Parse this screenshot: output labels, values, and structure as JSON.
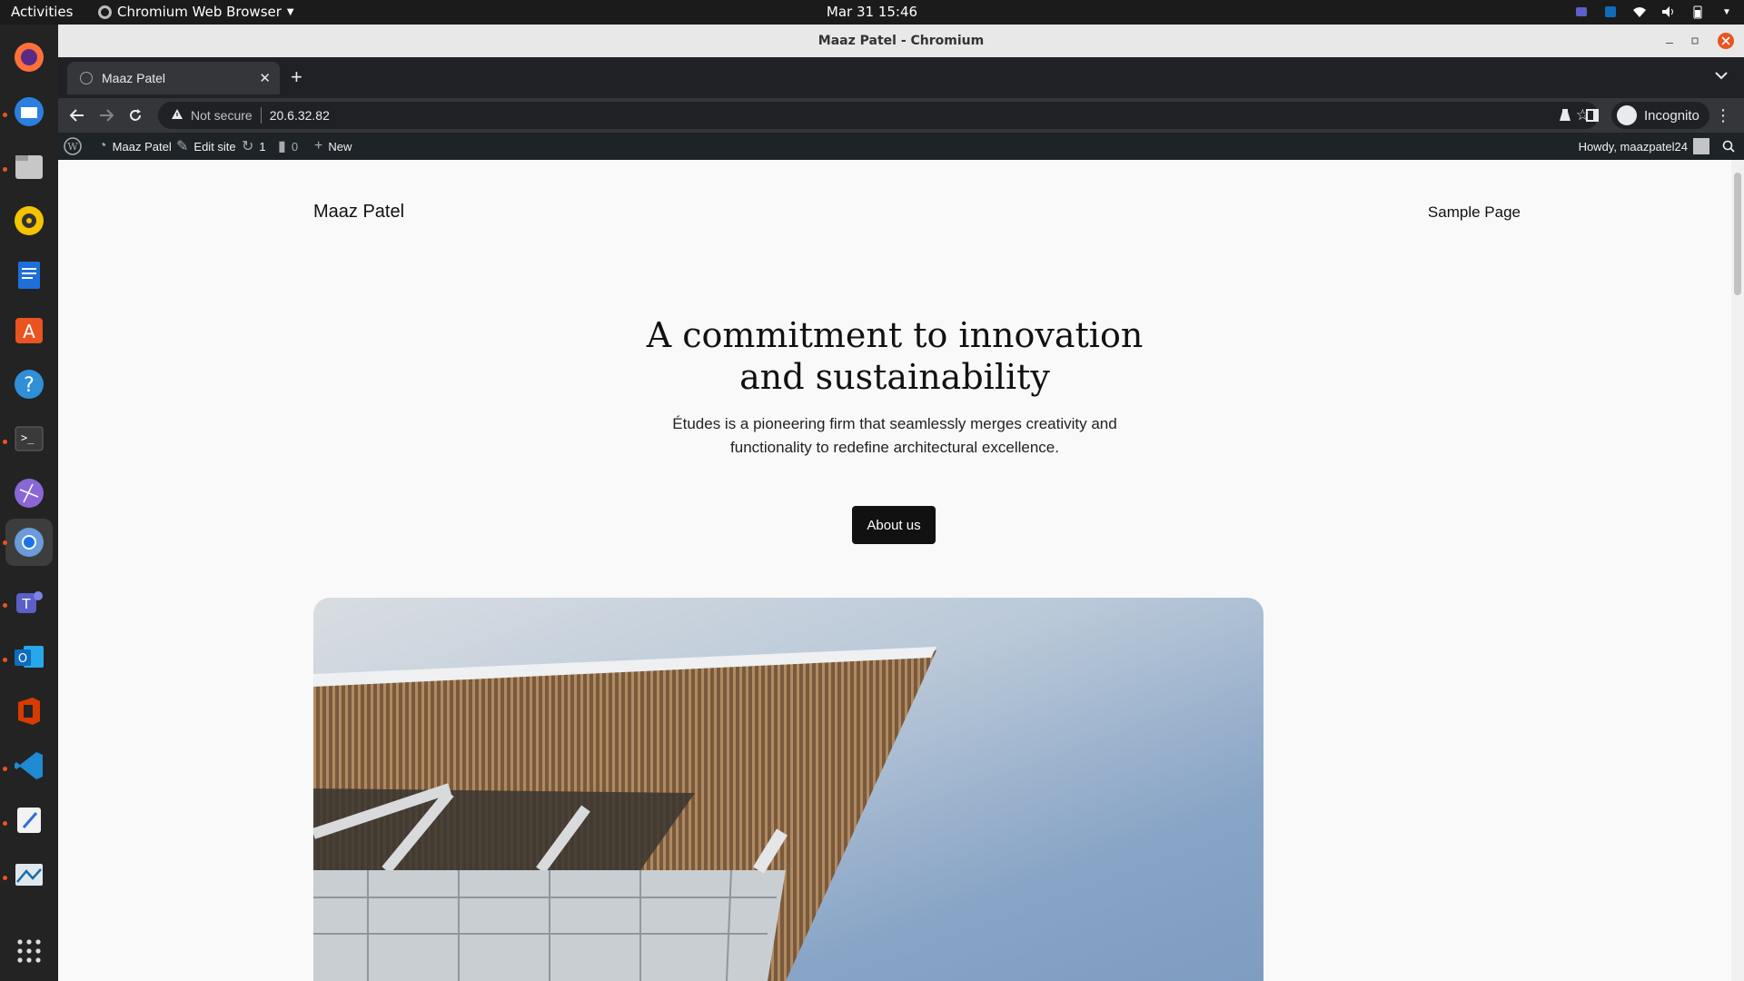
{
  "system": {
    "activities": "Activities",
    "app_menu": "Chromium Web Browser",
    "clock": "Mar 31  15:46"
  },
  "dock": {
    "apps": [
      "firefox-icon",
      "thunderbird-icon",
      "files-icon",
      "rhythmbox-icon",
      "writer-icon",
      "app-center-icon",
      "help-icon",
      "terminal-icon",
      "network-icon",
      "chromium-icon",
      "teams-icon",
      "outlook-icon",
      "office-icon",
      "vscode-icon",
      "text-editor-icon",
      "screenshot-icon",
      "show-apps-icon"
    ]
  },
  "browser": {
    "window_title": "Maaz Patel - Chromium",
    "tab_title": "Maaz Patel",
    "security": "Not secure",
    "url": "20.6.32.82",
    "profile": "Incognito"
  },
  "wp_admin_bar": {
    "site_name": "Maaz Patel",
    "edit_site": "Edit site",
    "updates_count": "1",
    "comments_count": "0",
    "new_label": "New",
    "howdy": "Howdy, maazpatel24"
  },
  "site": {
    "title": "Maaz Patel",
    "nav_link": "Sample Page",
    "hero_title_line1": "A commitment to innovation",
    "hero_title_line2": "and sustainability",
    "hero_text_line1": "Études is a pioneering firm that seamlessly merges creativity and",
    "hero_text_line2": "functionality to redefine architectural excellence.",
    "cta": "About us"
  }
}
